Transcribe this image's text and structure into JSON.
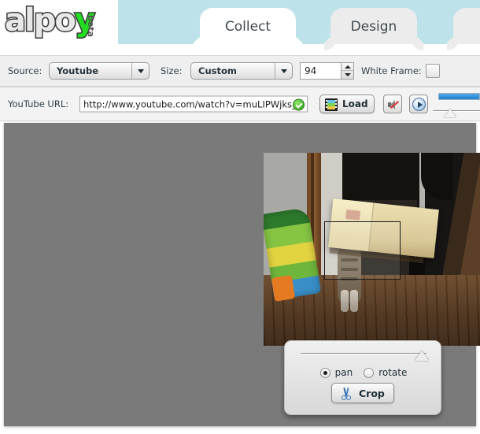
{
  "brand": {
    "name": "alpoy",
    "name_main": "alpo",
    "name_accent": "y",
    "beta_label": "beta",
    "accent_color": "#22dd22"
  },
  "tabs": [
    {
      "label": "Collect",
      "active": true
    },
    {
      "label": "Design",
      "active": false
    },
    {
      "label": "",
      "active": false
    }
  ],
  "toolbar": {
    "source_label": "Source:",
    "source_value": "Youtube",
    "size_label": "Size:",
    "size_value": "Custom",
    "size_number": "94",
    "white_frame_label": "White Frame:",
    "white_frame_checked": false
  },
  "urlbar": {
    "label": "YouTube URL:",
    "value": "http://www.youtube.com/watch?v=muLIPWjks_M",
    "valid_badge": "check-circle-icon",
    "load_label": "Load",
    "mute_icon": "speaker-mute-icon",
    "play_icon": "play-circle-icon",
    "progress_percent": 100
  },
  "crop_panel": {
    "mode_pan_label": "pan",
    "mode_rotate_label": "rotate",
    "mode_selected": "pan",
    "crop_button_label": "Crop",
    "zoom_slider_percent": 91
  },
  "colors": {
    "tabstrip": "#bee2ea",
    "stage": "#7a7a7a",
    "toolbar": "#efefef",
    "progress": "#1f7fd0"
  }
}
